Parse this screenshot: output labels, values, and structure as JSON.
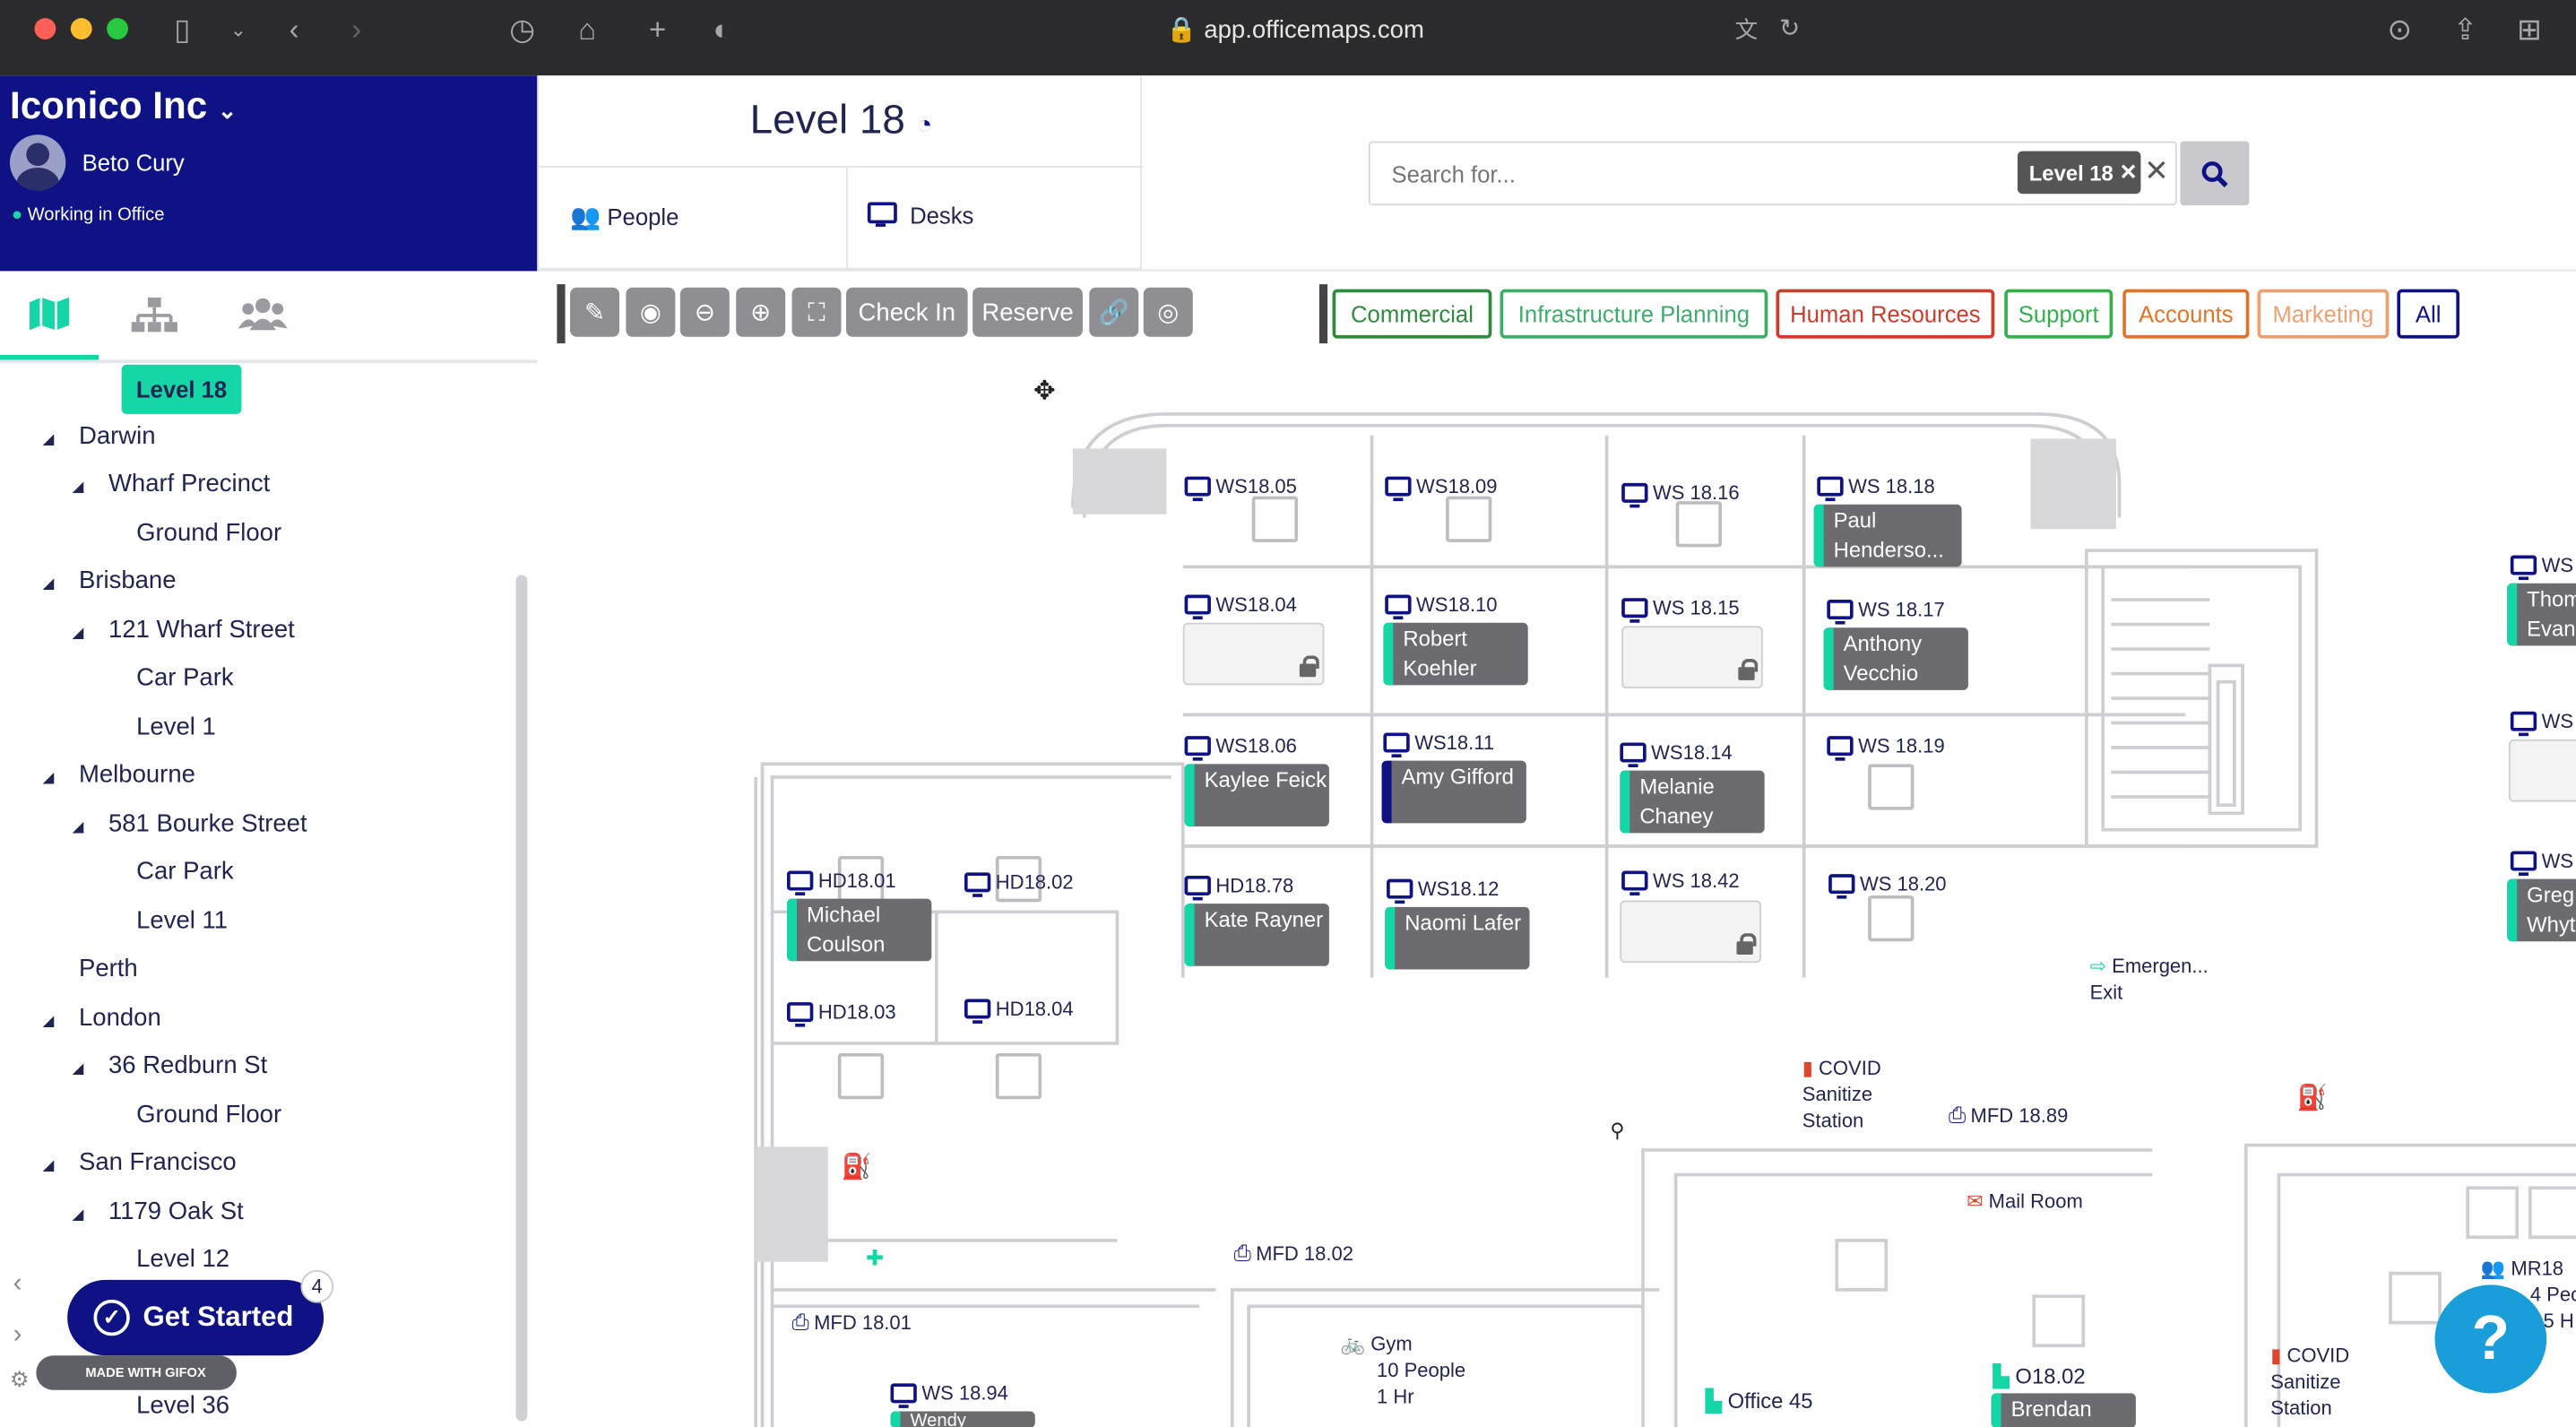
{
  "browser": {
    "url": "app.officemaps.com"
  },
  "org": {
    "name": "Iconico Inc",
    "user": "Beto Cury",
    "status": "Working in Office"
  },
  "level": {
    "title": "Level 18"
  },
  "tabs": {
    "people": "People",
    "desks": "Desks"
  },
  "search": {
    "placeholder": "Search for...",
    "chip": "Level 18"
  },
  "toolbar": {
    "check_in": "Check In",
    "reserve": "Reserve"
  },
  "categories": [
    {
      "label": "Commercial",
      "color": "#2e8b3e"
    },
    {
      "label": "Infrastructure Planning",
      "color": "#3cae6a"
    },
    {
      "label": "Human Resources",
      "color": "#d23a2a"
    },
    {
      "label": "Support",
      "color": "#32b04a"
    },
    {
      "label": "Accounts",
      "color": "#e0742a"
    },
    {
      "label": "Marketing",
      "color": "#f0a070"
    },
    {
      "label": "All",
      "color": "#0e1285"
    }
  ],
  "tree": {
    "selected": "Level 18",
    "items": [
      "Darwin",
      "Wharf Precinct",
      "Ground Floor",
      "Brisbane",
      "121 Wharf Street",
      "Car Park",
      "Level 1",
      "Melbourne",
      "581 Bourke Street",
      "Car Park",
      "Level 11",
      "Perth",
      "London",
      "36 Redburn St",
      "Ground Floor",
      "San Francisco",
      "1179 Oak St",
      "Level 12",
      "Level 36"
    ]
  },
  "get_started": {
    "label": "Get Started",
    "badge": "4",
    "gifox": "MADE WITH GIFOX"
  },
  "desks": {
    "ws1805": "WS18.05",
    "ws1809": "WS18.09",
    "ws1816": "WS 18.16",
    "ws1818": "WS 18.18",
    "ws1804": "WS18.04",
    "ws1810": "WS18.10",
    "ws1815": "WS 18.15",
    "ws1817": "WS 18.17",
    "ws1806": "WS18.06",
    "ws1811": "WS18.11",
    "ws1814": "WS18.14",
    "ws1819": "WS 18.19",
    "hd1878": "HD18.78",
    "ws1812": "WS18.12",
    "ws1842": "WS 18.42",
    "ws1820": "WS 18.20",
    "hd1801": "HD18.01",
    "hd1802": "HD18.02",
    "hd1803": "HD18.03",
    "hd1804": "HD18.04",
    "ws1894": "WS 18.94",
    "mfd1802": "MFD 18.02",
    "mfd1801": "MFD 18.01",
    "mfd1889": "MFD 18.89",
    "o1802": "O18.02",
    "office45": "Office 45",
    "ws_r1": "WS",
    "ws_r2": "WS",
    "ws_r3": "WS",
    "mr": "MR18"
  },
  "people": {
    "paul": "Paul Henderso...",
    "robert": "Robert Koehler",
    "anthony": "Anthony Vecchio",
    "kaylee": "Kaylee Feick",
    "amy": "Amy Gifford",
    "melanie": "Melanie Chaney",
    "kate": "Kate Rayner",
    "naomi": "Naomi Lafer",
    "michael": "Michael Coulson",
    "brendan": "Brendan",
    "thom": "Thom Evan",
    "greg": "Greg Whyt",
    "wendy": "Wendy"
  },
  "labels": {
    "emergency": "Emergen... Exit",
    "covid1": "COVID Sanitize Station",
    "covid2": "COVID Sanitize Station",
    "mailroom": "Mail Room",
    "gym": "Gym",
    "gym2": "10 People",
    "gym3": "1 Hr",
    "mr2": "4 Peo",
    "mr3": "5 H"
  }
}
